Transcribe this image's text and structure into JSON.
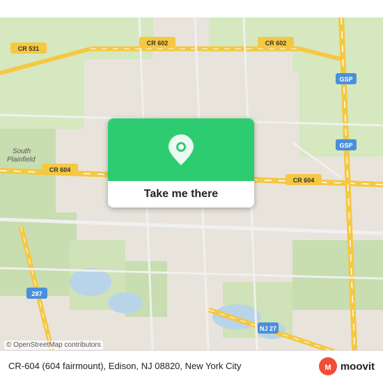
{
  "map": {
    "alt": "Map of Edison, NJ area showing CR-604 Fairmount"
  },
  "card": {
    "button_label": "Take me there"
  },
  "bottom_bar": {
    "address": "CR-604 (604 fairmount), Edison, NJ 08820, New York City"
  },
  "attribution": {
    "text": "© OpenStreetMap contributors"
  },
  "moovit": {
    "label": "moovit"
  },
  "colors": {
    "map_green": "#2ecc71",
    "road_yellow": "#f5d76e",
    "land": "#e8e0d8",
    "grass": "#c9d9b0",
    "water": "#b0cfe8"
  }
}
